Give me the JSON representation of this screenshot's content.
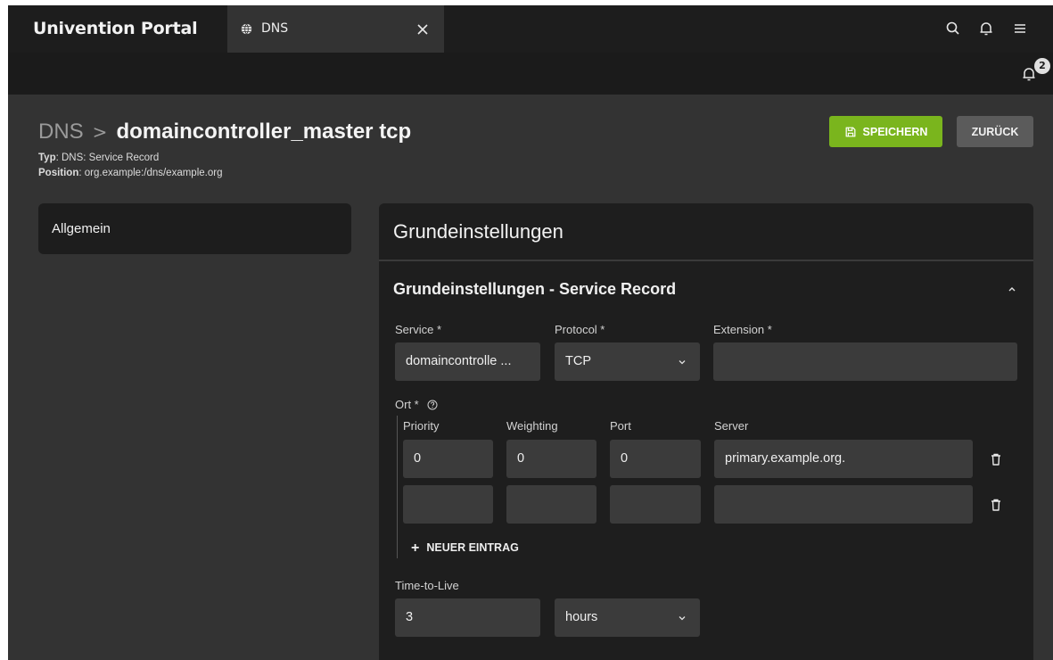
{
  "app": {
    "title": "Univention Portal",
    "tab_label": "DNS",
    "notifications_count": "2"
  },
  "header": {
    "breadcrumb_root": "DNS",
    "breadcrumb_separator": ">",
    "title": "domaincontroller_master tcp",
    "type_label": "Typ",
    "type_value": ": DNS: Service Record",
    "position_label": "Position",
    "position_value": ": org.example:/dns/example.org",
    "save_label": "SPEICHERN",
    "back_label": "ZURÜCK"
  },
  "sidebar": {
    "items": [
      {
        "label": "Allgemein"
      }
    ]
  },
  "card": {
    "title": "Grundeinstellungen",
    "section_title": "Grundeinstellungen - Service Record",
    "service": {
      "label": "Service *",
      "value": "domaincontrolle ..."
    },
    "protocol": {
      "label": "Protocol *",
      "value": "TCP"
    },
    "extension": {
      "label": "Extension *",
      "value": ""
    },
    "location": {
      "label": "Ort *",
      "columns": [
        "Priority",
        "Weighting",
        "Port",
        "Server"
      ],
      "rows": [
        {
          "priority": "0",
          "weighting": "0",
          "port": "0",
          "server": "primary.example.org."
        },
        {
          "priority": "",
          "weighting": "",
          "port": "",
          "server": ""
        }
      ],
      "add_label": "NEUER EINTRAG"
    },
    "ttl": {
      "label": "Time-to-Live",
      "value": "3",
      "unit": "hours"
    }
  },
  "colors": {
    "accent_green": "#7ab51d",
    "background": "#333333",
    "card": "#1e1e1e",
    "field": "#3b3b3b",
    "topbar": "#1d1d1d"
  }
}
